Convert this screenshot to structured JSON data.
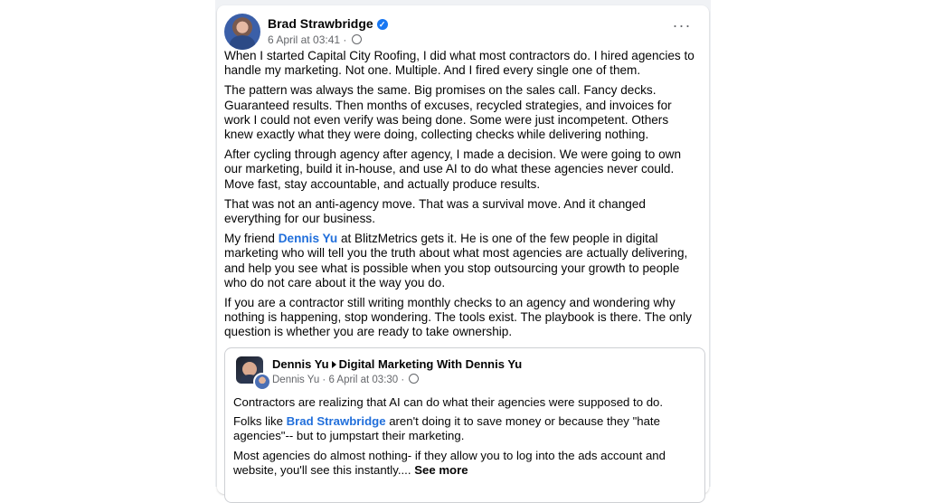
{
  "post": {
    "author": "Brad Strawbridge",
    "timestamp": "6 April at 03:41",
    "audience_icon": "globe-icon",
    "more_icon": "more-horizontal-icon",
    "more_label": "···",
    "paragraphs": [
      "When I started Capital City Roofing, I did what most contractors do. I hired agencies to handle my marketing. Not one. Multiple. And I fired every single one of them.",
      "The pattern was always the same. Big promises on the sales call. Fancy decks. Guaranteed results. Then months of excuses, recycled strategies, and invoices for work I could not even verify was being done. Some were just incompetent. Others knew exactly what they were doing, collecting checks while delivering nothing.",
      "After cycling through agency after agency, I made a decision. We were going to own our marketing, build it in-house, and use AI to do what these agencies never could. Move fast, stay accountable, and actually produce results.",
      "That was not an anti-agency move. That was a survival move. And it changed everything for our business."
    ],
    "p5_before": "My friend ",
    "p5_mention": "Dennis Yu",
    "p5_after": " at BlitzMetrics gets it. He is one of the few people in digital marketing who will tell you the truth about what most agencies are actually delivering, and help you see what is possible when you stop outsourcing your growth to people who do not care about it the way you do.",
    "p6": "If you are a contractor still writing monthly checks to an agency and wondering why nothing is happening, stop wondering. The tools exist. The playbook is there. The only question is whether you are ready to take ownership."
  },
  "shared": {
    "author": "Dennis Yu",
    "group": "Digital Marketing With Dennis Yu",
    "meta_author": "Dennis Yu",
    "timestamp": "6 April at 03:30",
    "p1": "Contractors are realizing that AI can do what their agencies were supposed to do.",
    "p2_before": "Folks like ",
    "p2_mention": "Brad Strawbridge",
    "p2_after": " aren't doing it to save money or because they \"hate agencies\"-- but to jumpstart their marketing.",
    "p3": "Most agencies do almost nothing- if they allow you to log into the ads account and website, you'll see this instantly.... ",
    "see_more": "See more"
  },
  "colors": {
    "link": "#216fdb",
    "verified": "#1877f2",
    "secondary_text": "#65676b"
  }
}
